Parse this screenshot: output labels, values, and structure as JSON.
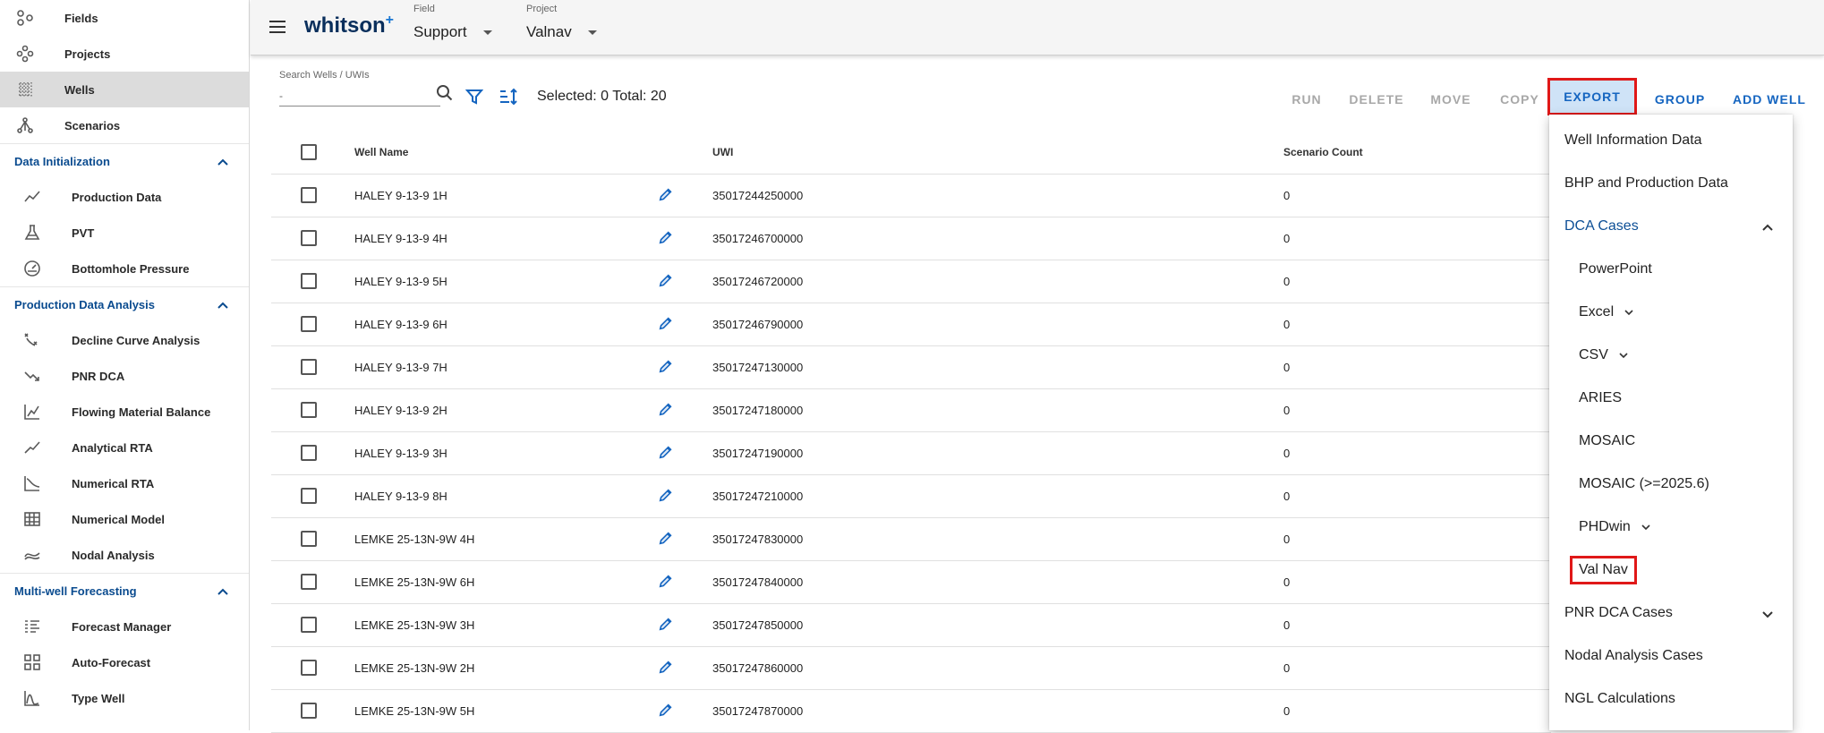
{
  "sidebar": {
    "top_items": [
      {
        "label": "Fields",
        "icon": "fields-icon"
      },
      {
        "label": "Projects",
        "icon": "projects-icon"
      },
      {
        "label": "Wells",
        "icon": "wells-icon",
        "active": true
      },
      {
        "label": "Scenarios",
        "icon": "scenarios-icon"
      }
    ],
    "sections": [
      {
        "title": "Data Initialization",
        "items": [
          {
            "label": "Production Data",
            "icon": "production-data-icon"
          },
          {
            "label": "PVT",
            "icon": "pvt-flask-icon"
          },
          {
            "label": "Bottomhole Pressure",
            "icon": "gauge-icon"
          }
        ]
      },
      {
        "title": "Production Data Analysis",
        "items": [
          {
            "label": "Decline Curve Analysis",
            "icon": "decline-curve-icon"
          },
          {
            "label": "PNR DCA",
            "icon": "pnr-dca-icon"
          },
          {
            "label": "Flowing Material Balance",
            "icon": "fmb-chart-icon"
          },
          {
            "label": "Analytical RTA",
            "icon": "analytical-rta-icon"
          },
          {
            "label": "Numerical RTA",
            "icon": "numerical-rta-icon"
          },
          {
            "label": "Numerical Model",
            "icon": "numerical-model-icon"
          },
          {
            "label": "Nodal Analysis",
            "icon": "nodal-analysis-icon"
          }
        ]
      },
      {
        "title": "Multi-well Forecasting",
        "items": [
          {
            "label": "Forecast Manager",
            "icon": "forecast-manager-icon"
          },
          {
            "label": "Auto-Forecast",
            "icon": "auto-forecast-icon"
          },
          {
            "label": "Type Well",
            "icon": "type-well-icon"
          }
        ]
      }
    ]
  },
  "header": {
    "brand": "whitson",
    "brand_sup": "+",
    "field_label": "Field",
    "field_value": "Support",
    "project_label": "Project",
    "project_value": "Valnav"
  },
  "toolbar": {
    "search_label": "Search Wells / UWIs",
    "search_value": "-",
    "selection_text": "Selected: 0 Total: 20",
    "buttons": {
      "run": "RUN",
      "delete": "DELETE",
      "move": "MOVE",
      "copy": "COPY",
      "export": "EXPORT",
      "group": "GROUP",
      "add_well": "ADD WELL"
    }
  },
  "table": {
    "headers": {
      "well_name": "Well Name",
      "uwi": "UWI",
      "scenario_count": "Scenario Count"
    },
    "rows": [
      {
        "name": "HALEY 9-13-9 1H",
        "uwi": "35017244250000",
        "count": "0"
      },
      {
        "name": "HALEY 9-13-9 4H",
        "uwi": "35017246700000",
        "count": "0"
      },
      {
        "name": "HALEY 9-13-9 5H",
        "uwi": "35017246720000",
        "count": "0"
      },
      {
        "name": "HALEY 9-13-9 6H",
        "uwi": "35017246790000",
        "count": "0"
      },
      {
        "name": "HALEY 9-13-9 7H",
        "uwi": "35017247130000",
        "count": "0"
      },
      {
        "name": "HALEY 9-13-9 2H",
        "uwi": "35017247180000",
        "count": "0"
      },
      {
        "name": "HALEY 9-13-9 3H",
        "uwi": "35017247190000",
        "count": "0"
      },
      {
        "name": "HALEY 9-13-9 8H",
        "uwi": "35017247210000",
        "count": "0"
      },
      {
        "name": "LEMKE 25-13N-9W 4H",
        "uwi": "35017247830000",
        "count": "0"
      },
      {
        "name": "LEMKE 25-13N-9W 6H",
        "uwi": "35017247840000",
        "count": "0"
      },
      {
        "name": "LEMKE 25-13N-9W 3H",
        "uwi": "35017247850000",
        "count": "0"
      },
      {
        "name": "LEMKE 25-13N-9W 2H",
        "uwi": "35017247860000",
        "count": "0"
      },
      {
        "name": "LEMKE 25-13N-9W 5H",
        "uwi": "35017247870000",
        "count": "0"
      }
    ]
  },
  "export_menu": {
    "well_information_data": "Well Information Data",
    "bhp_production_data": "BHP and Production Data",
    "dca_cases": "DCA Cases",
    "powerpoint": "PowerPoint",
    "excel": "Excel",
    "csv": "CSV",
    "aries": "ARIES",
    "mosaic": "MOSAIC",
    "mosaic_new": "MOSAIC (>=2025.6)",
    "phdwin": "PHDwin",
    "val_nav": "Val Nav",
    "pnr_dca_cases": "PNR DCA Cases",
    "nodal_analysis_cases": "Nodal Analysis Cases",
    "ngl_calculations": "NGL Calculations"
  },
  "colors": {
    "accent": "#1565c0",
    "highlight": "#e01818",
    "section": "#0a4b8f"
  }
}
